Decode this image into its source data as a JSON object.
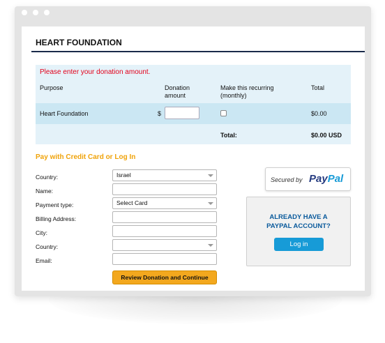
{
  "window": {
    "dots": [
      "",
      "",
      ""
    ]
  },
  "page": {
    "title": "HEART FOUNDATION"
  },
  "donation": {
    "error": "Please enter your donation amount.",
    "headers": {
      "purpose": "Purpose",
      "amount": "Donation amount",
      "recurring": "Make this recurring (monthly)",
      "total": "Total"
    },
    "row": {
      "purpose": "Heart Foundation",
      "currency": "$",
      "amount_value": "",
      "recurring_checked": false,
      "total": "$0.00"
    },
    "summary": {
      "label": "Total:",
      "value": "$0.00 USD"
    }
  },
  "payment": {
    "heading": "Pay with Credit Card or Log In",
    "fields": [
      {
        "label": "Country:",
        "value": "Israel",
        "type": "select"
      },
      {
        "label": "Name:",
        "value": "",
        "type": "text"
      },
      {
        "label": "Payment type:",
        "value": "Select Card",
        "type": "select"
      },
      {
        "label": "Billing Address:",
        "value": "",
        "type": "text"
      },
      {
        "label": "City:",
        "value": "",
        "type": "text"
      },
      {
        "label": "Country:",
        "value": "",
        "type": "select"
      },
      {
        "label": "Email:",
        "value": "",
        "type": "text"
      }
    ],
    "submit_label": "Review Donation and Continue"
  },
  "paypal": {
    "secured_text": "Secured by",
    "logo_pay": "Pay",
    "logo_pal": "Pal",
    "account_prompt_line1": "ALREADY HAVE A",
    "account_prompt_line2": "PAYPAL ACCOUNT?",
    "login_label": "Log in"
  },
  "colors": {
    "accent_orange": "#f0a30a",
    "error_red": "#e2001a",
    "paypal_navy": "#253b80",
    "paypal_blue": "#179bd7",
    "panel_bg": "#e4f2f9"
  }
}
